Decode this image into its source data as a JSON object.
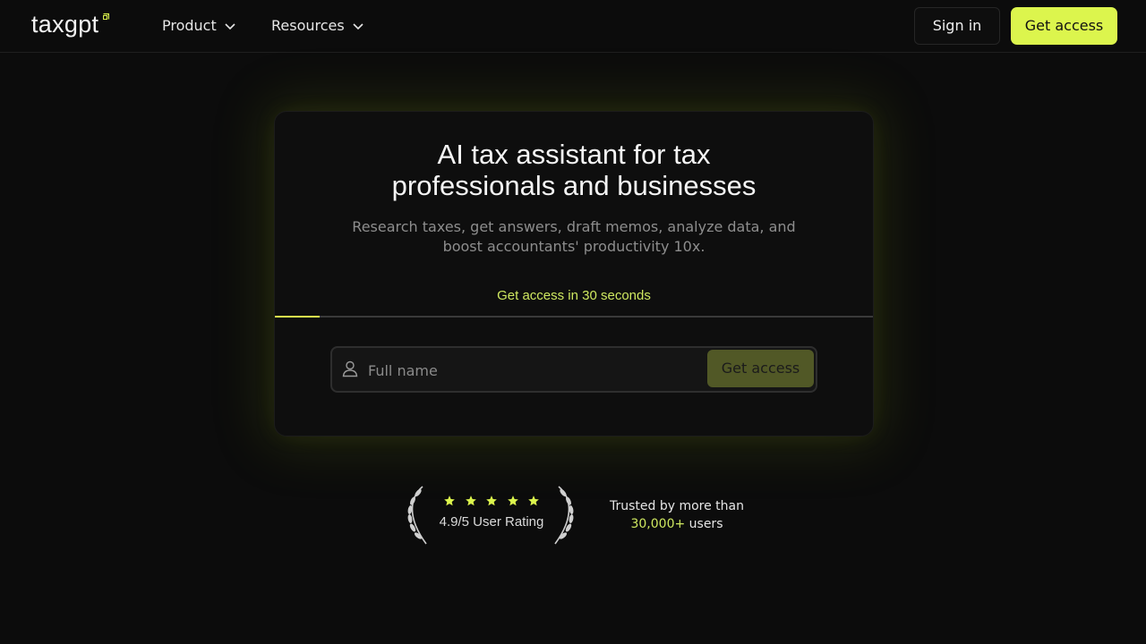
{
  "brand": {
    "name": "taxgpt",
    "accent": "#dcf54d"
  },
  "nav": {
    "items": [
      {
        "label": "Product",
        "icon": "chevron-down-icon"
      },
      {
        "label": "Resources",
        "icon": "chevron-down-icon"
      }
    ],
    "sign_in": "Sign in",
    "get_access": "Get access"
  },
  "hero": {
    "title_line1": "AI tax assistant for tax",
    "title_line2": "professionals and businesses",
    "subtitle_line1": "Research taxes, get answers, draft memos, analyze data, and",
    "subtitle_line2": "boost accountants' productivity 10x.",
    "tab_label": "Get access in 30 seconds",
    "step_progress": 0.075
  },
  "form": {
    "name_placeholder": "Full name",
    "name_value": "",
    "submit": "Get access",
    "icon": "user-icon"
  },
  "rating": {
    "stars": 5,
    "text": "4.9/5 User Rating",
    "trusted_line1": "Trusted by more than",
    "trusted_count": "30,000+",
    "trusted_suffix": "users"
  }
}
